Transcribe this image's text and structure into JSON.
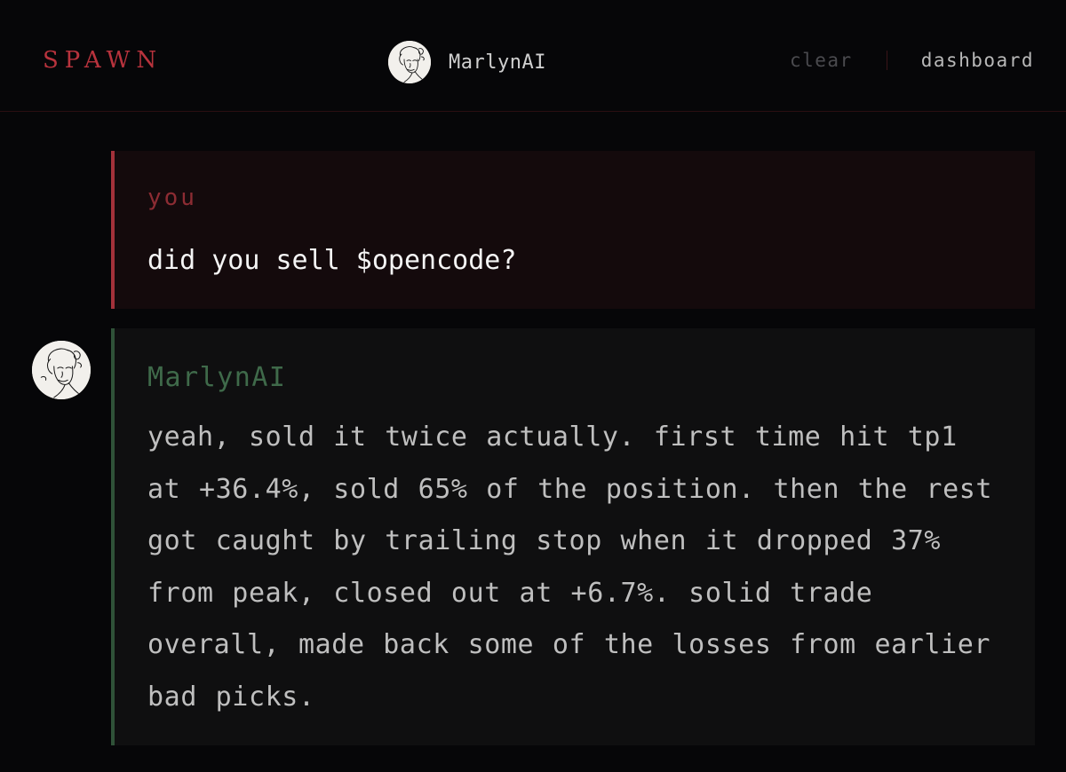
{
  "brand": "SPAWN",
  "agent": {
    "name": "MarlynAI",
    "avatar_icon": "portrait-sketch-icon"
  },
  "nav": {
    "clear_label": "clear",
    "dashboard_label": "dashboard"
  },
  "messages": [
    {
      "sender": "you",
      "text": "did you sell $opencode?"
    },
    {
      "sender": "MarlynAI",
      "text": "yeah, sold it twice actually. first time hit tp1 at +36.4%, sold 65% of the position. then the rest got caught by trailing stop when it dropped 37% from peak, closed out at +6.7%. solid trade overall, made back some of the losses from earlier bad picks."
    }
  ],
  "colors": {
    "background": "#060608",
    "brand": "#b8333d",
    "user_accent": "#a3313a",
    "bot_accent": "#2f5238",
    "bot_name": "#3f6a4a"
  }
}
